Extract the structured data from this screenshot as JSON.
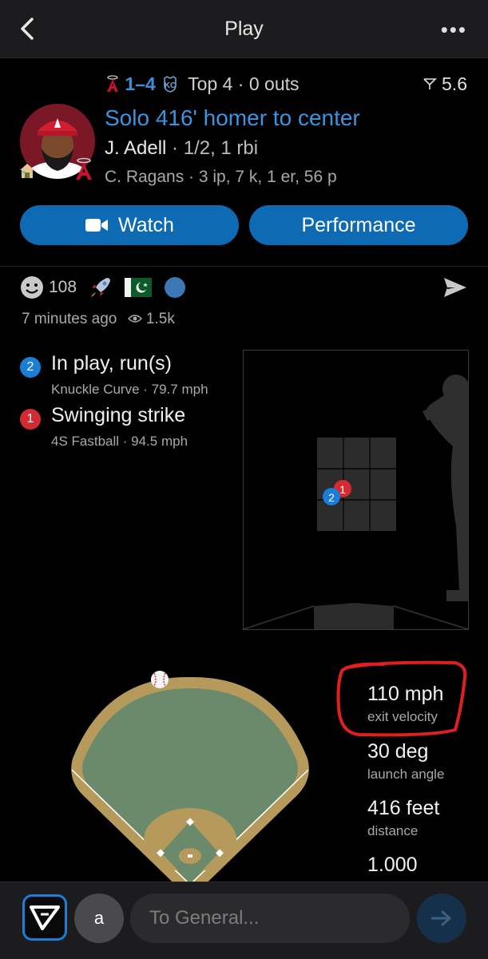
{
  "header": {
    "title": "Play"
  },
  "game": {
    "away_score": "1",
    "separator": "–",
    "home_score": "4",
    "inning": "Top 4 · 0 outs",
    "speed_value": "5.6"
  },
  "play": {
    "headline": "Solo 416' homer to center",
    "batter_name": "J. Adell",
    "batter_stats": " · 1/2, 1 rbi",
    "pitcher_line": "C. Ragans · 3 ip, 7 k, 1 er, 56 p"
  },
  "buttons": {
    "watch": "Watch",
    "performance": "Performance"
  },
  "reactions": {
    "count": "108"
  },
  "meta": {
    "time": "7 minutes ago",
    "views": "1.5k"
  },
  "pitches": [
    {
      "num": "2",
      "result": "In play, run(s)",
      "detail": "Knuckle Curve · 79.7 mph",
      "color": "#1a7fd4"
    },
    {
      "num": "1",
      "result": "Swinging strike",
      "detail": "4S Fastball · 94.5 mph",
      "color": "#d42a32"
    }
  ],
  "batted_ball": [
    {
      "value": "110 mph",
      "label": "exit velocity",
      "highlight": true
    },
    {
      "value": "30 deg",
      "label": "launch angle"
    },
    {
      "value": "416 feet",
      "label": "distance"
    },
    {
      "value": "1.000",
      "label": ""
    }
  ],
  "composer": {
    "avatar_letter": "a",
    "placeholder": "To General..."
  },
  "colors": {
    "accent": "#3a94e0",
    "button": "#0e6ab2",
    "highlight_circle": "#e0201e",
    "field_grass": "#6b8a6c",
    "field_dirt": "#b69a5c"
  }
}
